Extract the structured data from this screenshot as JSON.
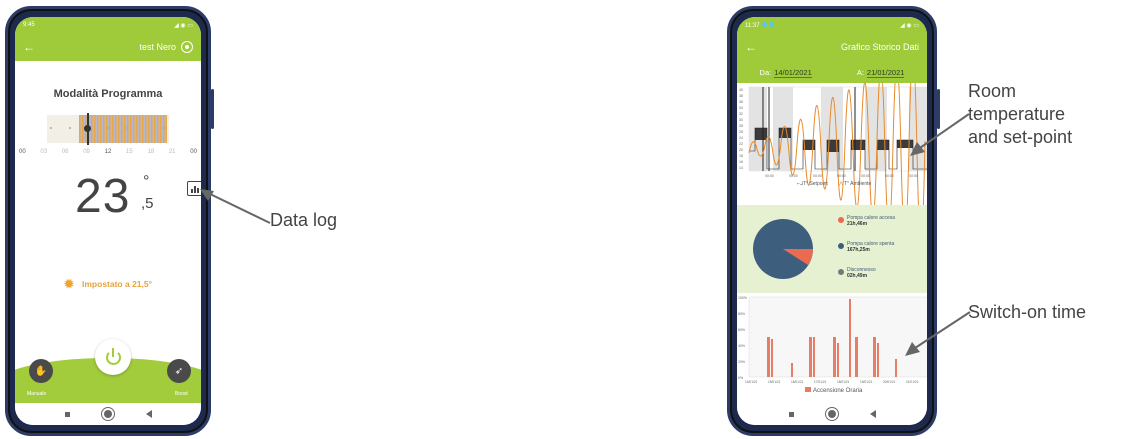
{
  "left_phone": {
    "status_time": "9:45",
    "header_title": "test Nero",
    "mode_title": "Modalità Programma",
    "hours": [
      "00",
      "03",
      "06",
      "09",
      "12",
      "15",
      "18",
      "21",
      "00"
    ],
    "temperature_integer": "23",
    "temperature_degree": "°",
    "temperature_decimal": ",5",
    "setpoint_text": "Impostato a 21,5°",
    "manual_label": "Manuale",
    "boost_label": "Boost"
  },
  "right_phone": {
    "status_time": "11:37",
    "header_title": "Grafico Storico Dati",
    "from_label": "Da:",
    "from_value": "14/01/2021",
    "to_label": "A:",
    "to_value": "21/01/2021",
    "y_ticks": [
      "40",
      "38",
      "36",
      "34",
      "32",
      "30",
      "28",
      "26",
      "24",
      "22",
      "20",
      "18",
      "16",
      "14"
    ],
    "x_ticks": [
      "00:00",
      "00:00",
      "00:00",
      "00:00",
      "00:00",
      "00:00",
      "00:00"
    ],
    "legend_setpoint": "T° Setpoint",
    "legend_ambient": "T° Ambiente",
    "pie_legend": [
      {
        "label": "Pompa calore accesa",
        "value": "21h,46m",
        "color": "#ea6b4f"
      },
      {
        "label": "Pompa calore spenta",
        "value": "167h,25m",
        "color": "#3d5e7d"
      },
      {
        "label": "Disconnesso",
        "value": "02h,49m",
        "color": "#777777"
      }
    ],
    "bar_y_ticks": [
      "100%",
      "80%",
      "60%",
      "40%",
      "20%",
      "0%"
    ],
    "bar_x_ticks": [
      "14/01/21",
      "15/01/21",
      "16/01/21",
      "17/01/21",
      "18/01/21",
      "19/01/21",
      "20/01/21",
      "21/01/21"
    ],
    "bar_legend": "Accensione Oraria"
  },
  "annotations": {
    "data_log": "Data log",
    "room_temp": [
      "Room",
      "temperature",
      "and set-point"
    ],
    "switch_on": "Switch-on time"
  }
}
